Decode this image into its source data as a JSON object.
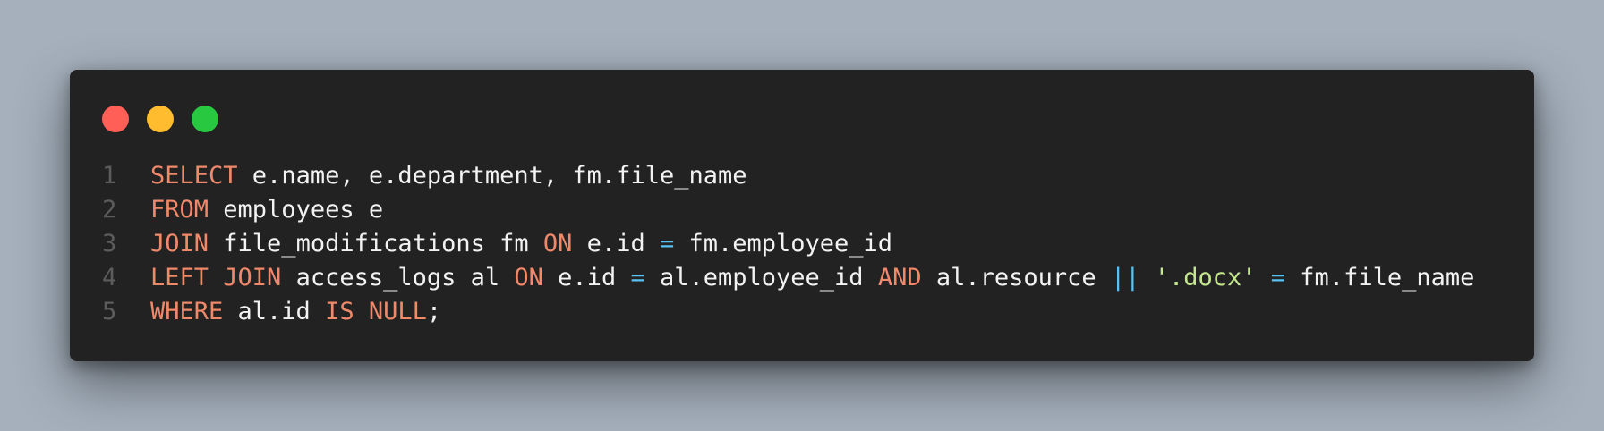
{
  "window": {
    "controls": [
      {
        "name": "close",
        "color": "#ff5f57"
      },
      {
        "name": "minimize",
        "color": "#febc2e"
      },
      {
        "name": "maximize",
        "color": "#28c840"
      }
    ]
  },
  "code": {
    "lines": [
      {
        "number": "1",
        "tokens": [
          {
            "type": "kw",
            "text": "SELECT"
          },
          {
            "type": "id",
            "text": " e.name, e.department, fm.file_name"
          }
        ]
      },
      {
        "number": "2",
        "tokens": [
          {
            "type": "kw",
            "text": "FROM"
          },
          {
            "type": "id",
            "text": " employees e"
          }
        ]
      },
      {
        "number": "3",
        "tokens": [
          {
            "type": "kw",
            "text": "JOIN"
          },
          {
            "type": "id",
            "text": " file_modifications fm "
          },
          {
            "type": "kw",
            "text": "ON"
          },
          {
            "type": "id",
            "text": " e.id "
          },
          {
            "type": "op",
            "text": "="
          },
          {
            "type": "id",
            "text": " fm.employee_id"
          }
        ]
      },
      {
        "number": "4",
        "tokens": [
          {
            "type": "kw",
            "text": "LEFT JOIN"
          },
          {
            "type": "id",
            "text": " access_logs al "
          },
          {
            "type": "kw",
            "text": "ON"
          },
          {
            "type": "id",
            "text": " e.id "
          },
          {
            "type": "op",
            "text": "="
          },
          {
            "type": "id",
            "text": " al.employee_id "
          },
          {
            "type": "kw",
            "text": "AND"
          },
          {
            "type": "id",
            "text": " al.resource "
          },
          {
            "type": "op",
            "text": "||"
          },
          {
            "type": "id",
            "text": " "
          },
          {
            "type": "str",
            "text": "'.docx'"
          },
          {
            "type": "id",
            "text": " "
          },
          {
            "type": "op",
            "text": "="
          },
          {
            "type": "id",
            "text": " fm.file_name"
          }
        ]
      },
      {
        "number": "5",
        "tokens": [
          {
            "type": "kw",
            "text": "WHERE"
          },
          {
            "type": "id",
            "text": " al.id "
          },
          {
            "type": "kw",
            "text": "IS NULL"
          },
          {
            "type": "id",
            "text": ";"
          }
        ]
      }
    ]
  }
}
